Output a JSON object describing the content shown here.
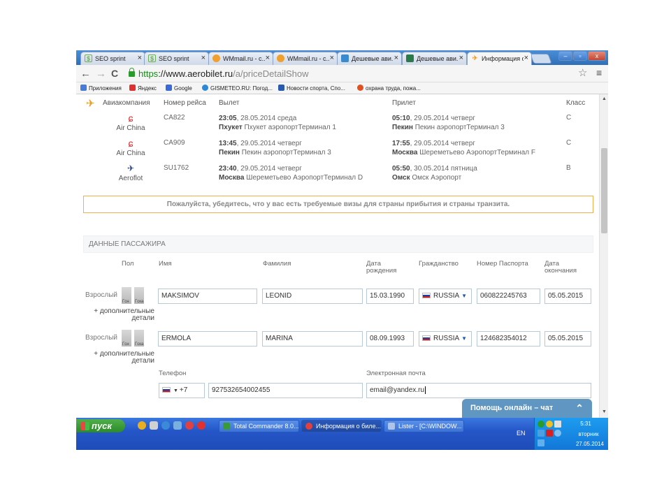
{
  "browser": {
    "tabs": [
      {
        "label": "SEO sprint",
        "icon": "seosprint-icon",
        "color": "#6ab04c"
      },
      {
        "label": "SEO sprint",
        "icon": "seosprint-icon",
        "color": "#6ab04c"
      },
      {
        "label": "WMmail.ru - с...",
        "icon": "wmmail-icon",
        "color": "#f0a030"
      },
      {
        "label": "WMmail.ru - с...",
        "icon": "wmmail-icon",
        "color": "#f0a030"
      },
      {
        "label": "Дешевые ави...",
        "icon": "flight-icon",
        "color": "#3a8ad0"
      },
      {
        "label": "Дешевые ави...",
        "icon": "flight-icon",
        "color": "#2a7a4a"
      },
      {
        "label": "Информация о...",
        "icon": "aerobilet-icon",
        "color": "#f39a1d"
      }
    ],
    "url_scheme": "https",
    "url_host": "://www.aerobilet.ru",
    "url_path": "/a/priceDetailShow",
    "bookmarks": [
      {
        "label": "Приложения",
        "color": "#4a7ad8"
      },
      {
        "label": "Яндекс",
        "color": "#e03030"
      },
      {
        "label": "Google",
        "color": "#3a6ad8"
      },
      {
        "label": "GISMETEO.RU: Погод...",
        "color": "#2a8ad8"
      },
      {
        "label": "Новости спорта, Спо...",
        "color": "#2a5ab0"
      },
      {
        "label": "охрана труда, пожа...",
        "color": "#e05020"
      }
    ]
  },
  "flights": {
    "headers": {
      "airline": "Авиакомпания",
      "flight_no": "Номер рейса",
      "departure": "Вылет",
      "arrival": "Прилет",
      "class": "Класс"
    },
    "rows": [
      {
        "airline": "Air China",
        "flight_no": "CA822",
        "dep_time": "23:05",
        "dep_date": ", 28.05.2014 среда",
        "dep_city": "Пхукет",
        "dep_airport": " Пхукет аэропортТерминал  1",
        "arr_time": "05:10",
        "arr_date": ", 29.05.2014 четверг",
        "arr_city": "Пекин",
        "arr_airport": " Пекин аэропортТерминал  3",
        "class": "C"
      },
      {
        "airline": "Air China",
        "flight_no": "CA909",
        "dep_time": "13:45",
        "dep_date": ", 29.05.2014 четверг",
        "dep_city": "Пекин",
        "dep_airport": " Пекин аэропортТерминал  3",
        "arr_time": "17:55",
        "arr_date": ", 29.05.2014 четверг",
        "arr_city": "Москва",
        "arr_airport": " Шереметьево АэропортТерминал  F",
        "class": "C"
      },
      {
        "airline": "Aeroflot",
        "flight_no": "SU1762",
        "dep_time": "23:40",
        "dep_date": ", 29.05.2014 четверг",
        "dep_city": "Москва",
        "dep_airport": " Шереметьево АэропортТерминал  D",
        "arr_time": "05:50",
        "arr_date": ", 30.05.2014 пятница",
        "arr_city": "Омск",
        "arr_airport": " Омск Аэропорт",
        "class": "B"
      }
    ]
  },
  "visa_notice": "Пожалуйста, убедитесь, что у вас есть требуемые визы для страны прибытия и страны транзита.",
  "passengers": {
    "section_title": "ДАННЫЕ ПАССАЖИРА",
    "headers": {
      "gender": "Пол",
      "first_name": "Имя",
      "last_name": "Фамилия",
      "birth_1": "Дата",
      "birth_2": "рождения",
      "citizenship": "Гражданство",
      "passport": "Номер Паспорта",
      "expiry_1": "Дата",
      "expiry_2": "окончания"
    },
    "gender_m": "Гсн",
    "gender_f": "Гска",
    "more_1": "+ дополнительные",
    "more_2": "детали",
    "rows": [
      {
        "type": "Взрослый",
        "first_name": "MAKSIMOV",
        "last_name": "LEONID",
        "birth": "15.03.1990",
        "citizenship": "RUSSIA",
        "passport": "060822245763",
        "expiry": "05.05.2015"
      },
      {
        "type": "Взрослый",
        "first_name": "ERMOLA",
        "last_name": "MARINA",
        "birth": "08.09.1993",
        "citizenship": "RUSSIA",
        "passport": "124682354012",
        "expiry": "05.05.2015"
      }
    ]
  },
  "contact": {
    "phone_label": "Телефон",
    "email_label": "Электронная почта",
    "country_code": "+7",
    "phone": "927532654002455",
    "email": "email@yandex.ru"
  },
  "chat": {
    "label": "Помощь онлайн – чат"
  },
  "taskbar": {
    "start": "пуск",
    "tasks": [
      {
        "label": "Total Commander 8.0...",
        "color": "#3a9a3a"
      },
      {
        "label": "Информация о биле...",
        "color": "#e04040"
      },
      {
        "label": "Lister - [C:\\WINDOW...",
        "color": "#b0c4e8"
      }
    ],
    "lang": "EN",
    "time": "5:31",
    "weekday": "вторник",
    "date": "27.05.2014"
  }
}
